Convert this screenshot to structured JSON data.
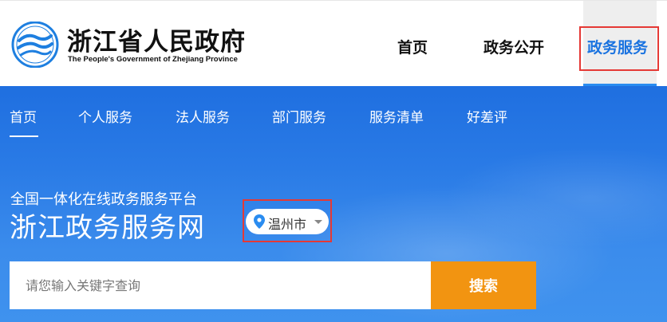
{
  "header": {
    "brand_cn": "浙江省人民政府",
    "brand_en": "The People's Government of Zhejiang Province",
    "nav": [
      {
        "label": "首页",
        "active": false
      },
      {
        "label": "政务公开",
        "active": false
      },
      {
        "label": "政务服务",
        "active": true
      }
    ]
  },
  "subnav": {
    "items": [
      {
        "label": "首页",
        "active": true
      },
      {
        "label": "个人服务"
      },
      {
        "label": "法人服务"
      },
      {
        "label": "部门服务"
      },
      {
        "label": "服务清单"
      },
      {
        "label": "好差评"
      }
    ]
  },
  "hero": {
    "platform_label": "全国一体化在线政务服务平台",
    "site_title": "浙江政务服务网",
    "city": "温州市"
  },
  "search": {
    "placeholder": "请您输入关键字查询",
    "button_label": "搜索"
  },
  "colors": {
    "accent_blue": "#1a73e0",
    "banner_blue": "#2a7be6",
    "search_orange": "#f29411",
    "highlight_red": "#e53935"
  },
  "icons": [
    "zhejiang-logo-icon",
    "location-pin-icon",
    "caret-down-icon"
  ]
}
